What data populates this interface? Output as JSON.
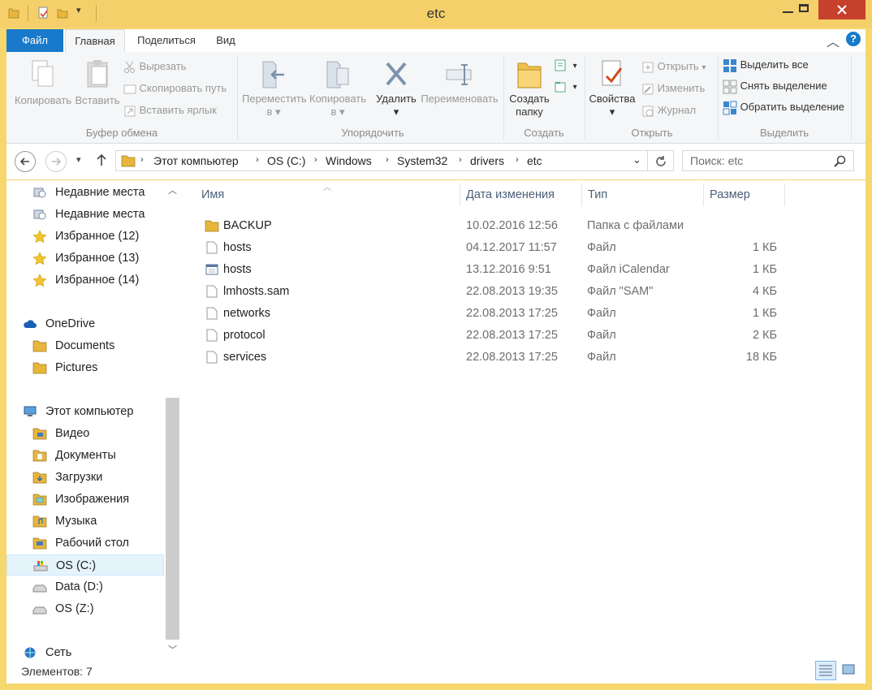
{
  "window": {
    "title": "etc"
  },
  "ribbon_tabs": [
    "Файл",
    "Главная",
    "Поделиться",
    "Вид"
  ],
  "ribbon": {
    "clipboard": {
      "copy": "Копировать",
      "paste": "Вставить",
      "cut": "Вырезать",
      "copy_path": "Скопировать путь",
      "paste_shortcut": "Вставить ярлык",
      "label": "Буфер обмена"
    },
    "organize": {
      "move_to_1": "Переместить",
      "move_to_2": "в",
      "copy_to_1": "Копировать",
      "copy_to_2": "в",
      "delete": "Удалить",
      "rename": "Переименовать",
      "label": "Упорядочить"
    },
    "new": {
      "new_folder_1": "Создать",
      "new_folder_2": "папку",
      "label": "Создать"
    },
    "open": {
      "properties": "Свойства",
      "open": "Открыть",
      "edit": "Изменить",
      "history": "Журнал",
      "label": "Открыть"
    },
    "select": {
      "select_all": "Выделить все",
      "select_none": "Снять выделение",
      "invert": "Обратить выделение",
      "label": "Выделить"
    }
  },
  "address": {
    "crumbs": [
      "Этот компьютер",
      "OS (C:)",
      "Windows",
      "System32",
      "drivers",
      "etc"
    ],
    "search_placeholder": "Поиск: etc"
  },
  "nav": {
    "items": [
      {
        "label": "Недавние места",
        "icon": "recent-places-icon"
      },
      {
        "label": "Недавние места",
        "icon": "recent-places-icon"
      },
      {
        "label": "Избранное (12)",
        "icon": "star-icon"
      },
      {
        "label": "Избранное (13)",
        "icon": "star-icon"
      },
      {
        "label": "Избранное (14)",
        "icon": "star-icon"
      },
      {
        "label": "OneDrive",
        "icon": "cloud-icon"
      },
      {
        "label": "Documents",
        "icon": "folder-icon"
      },
      {
        "label": "Pictures",
        "icon": "folder-icon"
      },
      {
        "label": "Этот компьютер",
        "icon": "computer-icon"
      },
      {
        "label": "Видео",
        "icon": "video-folder-icon"
      },
      {
        "label": "Документы",
        "icon": "documents-folder-icon"
      },
      {
        "label": "Загрузки",
        "icon": "downloads-folder-icon"
      },
      {
        "label": "Изображения",
        "icon": "pictures-folder-icon"
      },
      {
        "label": "Музыка",
        "icon": "music-folder-icon"
      },
      {
        "label": "Рабочий стол",
        "icon": "desktop-folder-icon"
      },
      {
        "label": "OS (C:)",
        "icon": "system-drive-icon"
      },
      {
        "label": "Data (D:)",
        "icon": "drive-icon"
      },
      {
        "label": "OS (Z:)",
        "icon": "drive-icon"
      },
      {
        "label": "Сеть",
        "icon": "network-icon"
      }
    ]
  },
  "columns": {
    "name": "Имя",
    "date": "Дата изменения",
    "type": "Тип",
    "size": "Размер"
  },
  "files": [
    {
      "name": "BACKUP",
      "date": "10.02.2016 12:56",
      "type": "Папка с файлами",
      "size": "",
      "icon": "folder-icon"
    },
    {
      "name": "hosts",
      "date": "04.12.2017 11:57",
      "type": "Файл",
      "size": "1 КБ",
      "icon": "file-icon"
    },
    {
      "name": "hosts",
      "date": "13.12.2016 9:51",
      "type": "Файл iCalendar",
      "size": "1 КБ",
      "icon": "calendar-file-icon"
    },
    {
      "name": "lmhosts.sam",
      "date": "22.08.2013 19:35",
      "type": "Файл \"SAM\"",
      "size": "4 КБ",
      "icon": "file-icon"
    },
    {
      "name": "networks",
      "date": "22.08.2013 17:25",
      "type": "Файл",
      "size": "1 КБ",
      "icon": "file-icon"
    },
    {
      "name": "protocol",
      "date": "22.08.2013 17:25",
      "type": "Файл",
      "size": "2 КБ",
      "icon": "file-icon"
    },
    {
      "name": "services",
      "date": "22.08.2013 17:25",
      "type": "Файл",
      "size": "18 КБ",
      "icon": "file-icon"
    }
  ],
  "status": {
    "count": "Элементов: 7"
  }
}
